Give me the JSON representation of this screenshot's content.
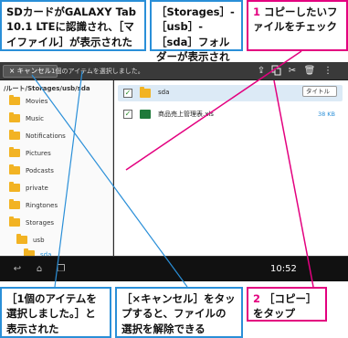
{
  "callouts": {
    "sdcard": "SDカードがGALAXY Tab 10.1 LTEに認識され、［マイファイル］が表示された",
    "storages": "［Storages］-［usb］-［sda］フォルダーが表示された",
    "check_num": "1",
    "check_text": "コピーしたいファイルをチェック",
    "selected": "［1個のアイテムを選択しました。］と表示された",
    "cancel": "［×キャンセル］をタップすると、ファイルの選択を解除できる",
    "copy_num": "2",
    "copy_text": "［コピー］をタップ"
  },
  "actionbar": {
    "cancel_label": "× キャンセル",
    "selected_text": "1個のアイテムを選択しました。",
    "icons": [
      "share-icon",
      "copy-icon",
      "cut-icon",
      "delete-icon",
      "menu-icon"
    ]
  },
  "left_pane": {
    "path": "/ルート/Storages/usb/sda",
    "items": [
      {
        "label": "Movies"
      },
      {
        "label": "Music"
      },
      {
        "label": "Notifications"
      },
      {
        "label": "Pictures"
      },
      {
        "label": "Podcasts"
      },
      {
        "label": "private"
      },
      {
        "label": "Ringtones"
      },
      {
        "label": "Storages"
      },
      {
        "label": "usb"
      },
      {
        "label": "sda"
      }
    ]
  },
  "right_pane": {
    "sort_label": "タイトル",
    "rows": [
      {
        "name": "sda",
        "size": ""
      },
      {
        "name": "商品売上管理表.xls",
        "size": "38 KB"
      }
    ]
  },
  "navbar": {
    "clock": "10:52",
    "icons": [
      "back-icon",
      "home-icon",
      "recent-apps-icon"
    ]
  },
  "colors": {
    "callout_blue": "#2a8fd8",
    "accent_pink": "#e3007f",
    "folder": "#f2b323"
  }
}
